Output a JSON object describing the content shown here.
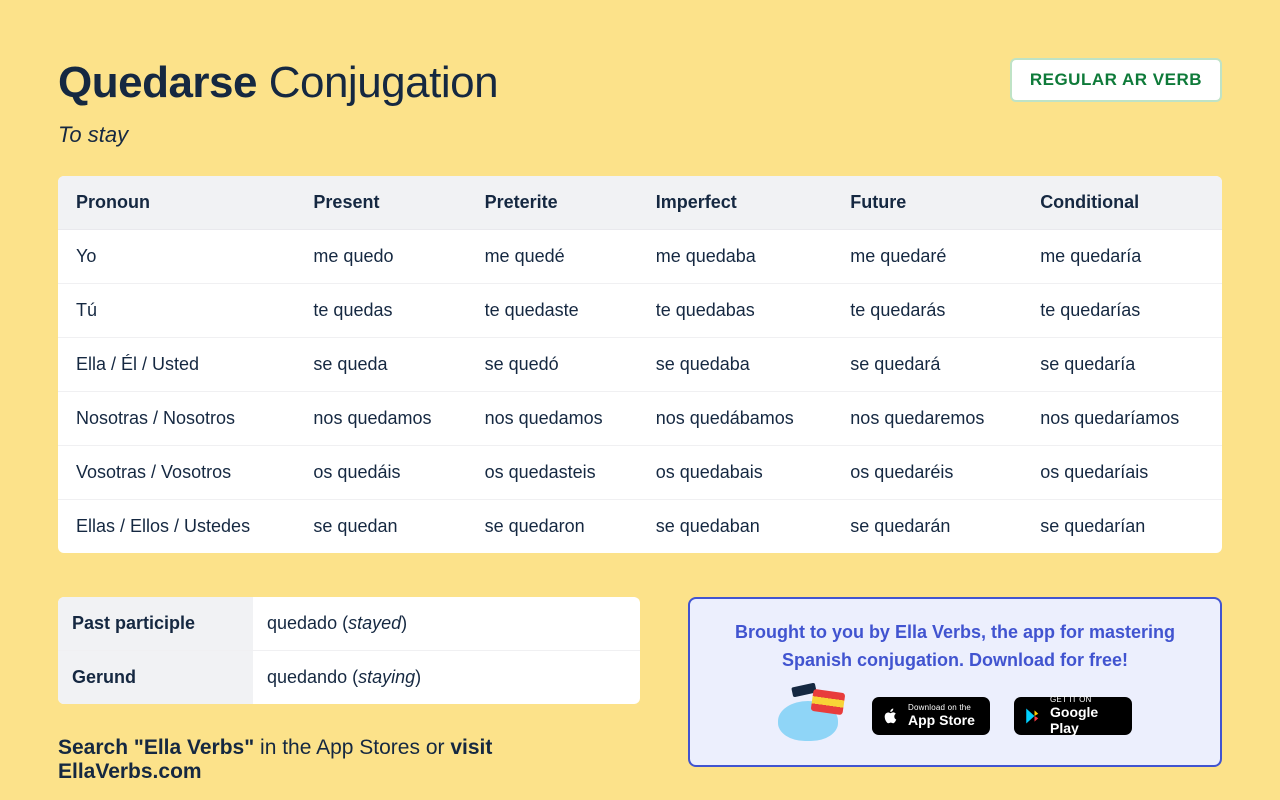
{
  "header": {
    "verb": "Quedarse",
    "title_suffix": " Conjugation",
    "subtitle": "To stay",
    "badge": "REGULAR AR VERB"
  },
  "table": {
    "headers": [
      "Pronoun",
      "Present",
      "Preterite",
      "Imperfect",
      "Future",
      "Conditional"
    ],
    "rows": [
      [
        "Yo",
        "me quedo",
        "me quedé",
        "me quedaba",
        "me quedaré",
        "me quedaría"
      ],
      [
        "Tú",
        "te quedas",
        "te quedaste",
        "te quedabas",
        "te quedarás",
        "te quedarías"
      ],
      [
        "Ella / Él / Usted",
        "se queda",
        "se quedó",
        "se quedaba",
        "se quedará",
        "se quedaría"
      ],
      [
        "Nosotras / Nosotros",
        "nos quedamos",
        "nos quedamos",
        "nos quedábamos",
        "nos quedaremos",
        "nos quedaríamos"
      ],
      [
        "Vosotras / Vosotros",
        "os quedáis",
        "os quedasteis",
        "os quedabais",
        "os quedaréis",
        "os quedaríais"
      ],
      [
        "Ellas / Ellos / Ustedes",
        "se quedan",
        "se quedaron",
        "se quedaban",
        "se quedarán",
        "se quedarían"
      ]
    ]
  },
  "forms": {
    "past_participle": {
      "label": "Past participle",
      "value": "quedado",
      "gloss": "stayed"
    },
    "gerund": {
      "label": "Gerund",
      "value": "quedando",
      "gloss": "staying"
    }
  },
  "search_line": {
    "prefix": "Search \"Ella Verbs\"",
    "middle": " in the App Stores or ",
    "link": "visit EllaVerbs.com"
  },
  "promo": {
    "text": "Brought to you by Ella Verbs, the app for mastering Spanish conjugation. Download for free!",
    "appstore": {
      "small": "Download on the",
      "big": "App Store"
    },
    "play": {
      "small": "GET IT ON",
      "big": "Google Play"
    }
  }
}
